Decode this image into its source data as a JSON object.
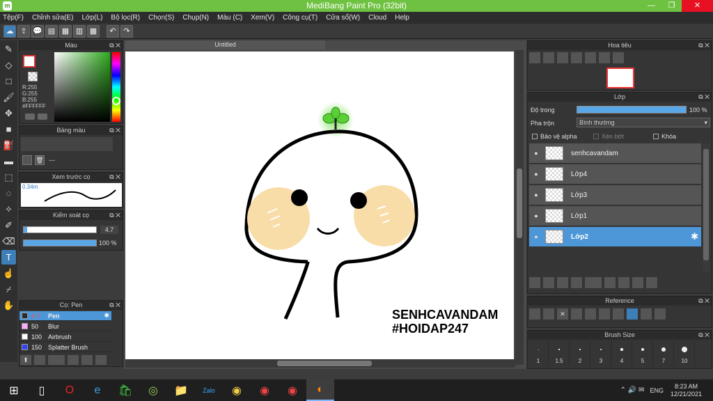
{
  "window": {
    "title": "MediBang Paint Pro (32bit)",
    "logo_glyph": "m",
    "min_glyph": "—",
    "max_glyph": "❐",
    "close_glyph": "✕"
  },
  "menu": [
    "Tệp(F)",
    "Chỉnh sửa(E)",
    "Lớp(L)",
    "Bộ lọc(R)",
    "Chọn(S)",
    "Chụp(N)",
    "Màu (C)",
    "Xem(V)",
    "Công cụ(T)",
    "Cửa sổ(W)",
    "Cloud",
    "Help"
  ],
  "toolbar": {
    "undo_glyph": "↶",
    "redo_glyph": "↷"
  },
  "color_panel": {
    "title": "Màu",
    "fg_color": "#ffffff",
    "rgb": [
      "R:255",
      "G:255",
      "B:255"
    ],
    "hex": "#FFFFFF"
  },
  "palette_panel": {
    "title": "Bảng màu",
    "row_label": "---"
  },
  "brush_preview": {
    "title": "Xem trước cọ",
    "size_label": "0.34m"
  },
  "brush_control": {
    "title": "Kiểm soát cọ",
    "size_value": "4.7",
    "opacity_value": "100 %",
    "size_fraction": 0.05,
    "opacity_fraction": 1.0
  },
  "brush_panel": {
    "title": "Cọ: Pen",
    "items": [
      {
        "size": "4.7",
        "name": "Pen",
        "swatch": "#2b2b2b"
      },
      {
        "size": "50",
        "name": "Blur",
        "swatch": "#ffaaff"
      },
      {
        "size": "100",
        "name": "Airbrush",
        "swatch": "#ffffff"
      },
      {
        "size": "150",
        "name": "Splatter Brush",
        "swatch": "#3344ff"
      }
    ]
  },
  "document": {
    "tab_title": "Untitled",
    "watermark_line1": "SENHCAVANDAM",
    "watermark_line2": "#HOIDAP247"
  },
  "navigator": {
    "title": "Hoa tiêu"
  },
  "layer_panel": {
    "title": "Lớp",
    "opacity_label": "Độ trong",
    "opacity_value": "100 %",
    "opacity_fraction": 1.0,
    "blend_label": "Pha trộn",
    "blend_value": "Bình thường",
    "protect_alpha": "Bảo vệ alpha",
    "clipping": "Xén bớt",
    "lock": "Khóa",
    "layers": [
      {
        "name": "senhcavandam",
        "active": false
      },
      {
        "name": "Lớp4",
        "active": false
      },
      {
        "name": "Lớp3",
        "active": false
      },
      {
        "name": "Lớp1",
        "active": false
      },
      {
        "name": "Lớp2",
        "active": true
      }
    ]
  },
  "reference_panel": {
    "title": "Reference"
  },
  "brush_size_panel": {
    "title": "Brush Size",
    "sizes": [
      "1",
      "1.5",
      "2",
      "3",
      "4",
      "5",
      "7",
      "10"
    ]
  },
  "taskbar": {
    "clock_time": "8:23 AM",
    "clock_date": "12/21/2021",
    "lang": "ENG",
    "apps": [
      "⊞",
      "🔍",
      "▯",
      "O",
      "e",
      "🛍",
      "◎",
      "📁",
      "Zalo",
      "◉",
      "C",
      "C",
      "◐"
    ]
  }
}
